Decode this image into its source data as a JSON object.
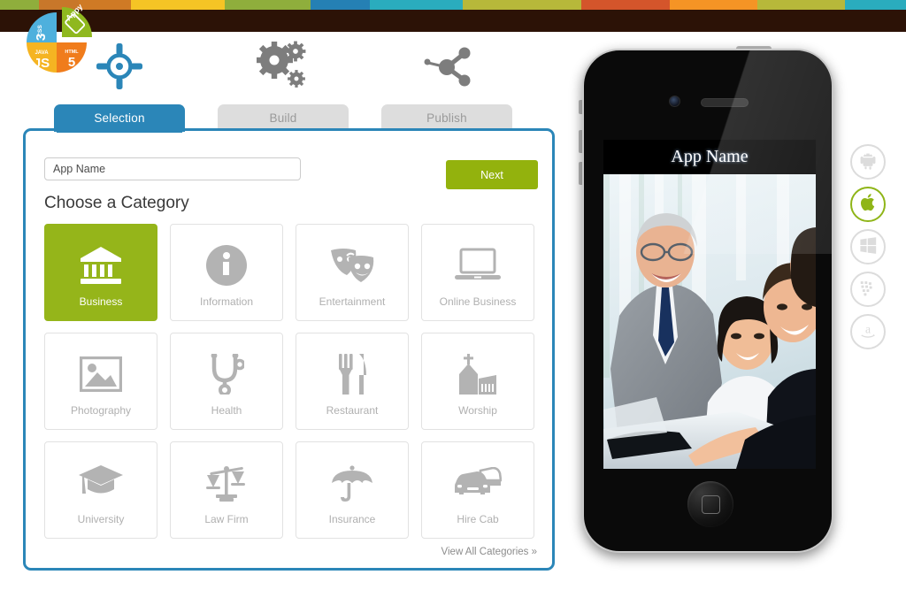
{
  "brand": {
    "logo_name": "appy-pie-logo",
    "segments": [
      {
        "label": "Appy",
        "color": "#8fb81f"
      },
      {
        "label": "HTML 5",
        "color": "#f07c1c"
      },
      {
        "label": "JAVA JS",
        "color": "#f5b422"
      },
      {
        "label": "CSS 3",
        "color": "#4eb0dd"
      }
    ]
  },
  "topbar": {
    "stripe_colors": [
      "#8fae3c",
      "#c8772a",
      "#cf7a25",
      "#f5c425",
      "#8fae3c",
      "#2580b4",
      "#2aacbe",
      "#b7b83a",
      "#d4552b",
      "#f59425",
      "#b7b83a",
      "#2aacbe"
    ],
    "stripe_widths": [
      66,
      68,
      88,
      158,
      146,
      100,
      158,
      200,
      150,
      148,
      148,
      104
    ],
    "bar_color": "#2c1206"
  },
  "steps": [
    {
      "label": "Selection",
      "icon": "target-icon",
      "state": "active"
    },
    {
      "label": "Build",
      "icon": "gears-icon",
      "state": "inactive"
    },
    {
      "label": "Publish",
      "icon": "share-icon",
      "state": "inactive"
    }
  ],
  "colors": {
    "accent_blue": "#2b86b8",
    "accent_green": "#95b51a",
    "button_green": "#93b20d",
    "inactive_tab": "#dddddd",
    "icon_grey": "#b3b3b3"
  },
  "form": {
    "app_name_value": "",
    "app_name_placeholder": "App Name",
    "next_label": "Next",
    "section_title": "Choose a Category",
    "view_all_label": "View All Categories »"
  },
  "categories": [
    {
      "label": "Business",
      "icon": "bank-icon",
      "selected": true
    },
    {
      "label": "Information",
      "icon": "info-circle-icon",
      "selected": false
    },
    {
      "label": "Entertainment",
      "icon": "theater-masks-icon",
      "selected": false
    },
    {
      "label": "Online Business",
      "icon": "laptop-icon",
      "selected": false
    },
    {
      "label": "Photography",
      "icon": "photo-icon",
      "selected": false
    },
    {
      "label": "Health",
      "icon": "stethoscope-icon",
      "selected": false
    },
    {
      "label": "Restaurant",
      "icon": "fork-knife-icon",
      "selected": false
    },
    {
      "label": "Worship",
      "icon": "church-icon",
      "selected": false
    },
    {
      "label": "University",
      "icon": "graduation-cap-icon",
      "selected": false
    },
    {
      "label": "Law Firm",
      "icon": "scales-icon",
      "selected": false
    },
    {
      "label": "Insurance",
      "icon": "umbrella-icon",
      "selected": false
    },
    {
      "label": "Hire Cab",
      "icon": "cars-icon",
      "selected": false
    }
  ],
  "preview": {
    "device": "iphone-4",
    "app_title": "App Name",
    "photo_alt": "business-team-photo"
  },
  "platforms": [
    {
      "name": "android",
      "icon": "android-icon",
      "active": false
    },
    {
      "name": "ios",
      "icon": "apple-icon",
      "active": true
    },
    {
      "name": "windows",
      "icon": "windows-icon",
      "active": false
    },
    {
      "name": "blackberry",
      "icon": "blackberry-icon",
      "active": false
    },
    {
      "name": "amazon",
      "icon": "amazon-icon",
      "active": false
    }
  ]
}
